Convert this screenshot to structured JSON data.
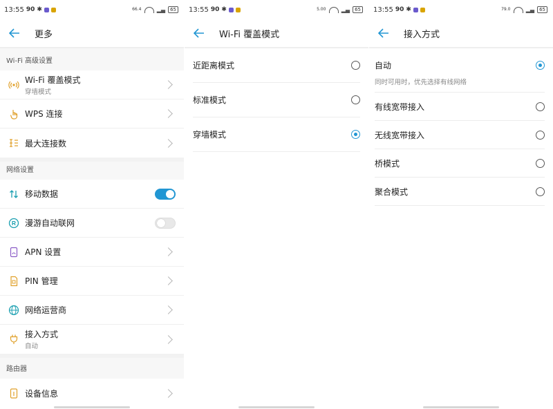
{
  "status": {
    "p1": {
      "time": "13:55",
      "sig": "90",
      "speed": "66.4",
      "batt": "65"
    },
    "p2": {
      "time": "13:55",
      "sig": "90",
      "speed": "5.00",
      "batt": "65"
    },
    "p3": {
      "time": "13:55",
      "sig": "90",
      "speed": "79.0",
      "batt": "65"
    }
  },
  "colors": {
    "accent": "#2196d3",
    "icon_orange": "#e0a02a",
    "icon_teal": "#1a9fb0",
    "icon_purple": "#8a5bc6"
  },
  "panel1": {
    "title": "更多",
    "sections": [
      {
        "label": "Wi-Fi 高级设置"
      },
      {
        "label": "网络设置"
      },
      {
        "label": "路由器"
      }
    ],
    "wifi_items": [
      {
        "label": "Wi-Fi 覆盖模式",
        "sub": "穿墙模式",
        "icon": "wifi-signal-icon"
      },
      {
        "label": "WPS 连接",
        "icon": "hand-tap-icon"
      },
      {
        "label": "最大连接数",
        "icon": "connection-list-icon"
      }
    ],
    "network_items": [
      {
        "label": "移动数据",
        "icon": "data-arrows-icon",
        "toggle": true
      },
      {
        "label": "漫游自动联网",
        "icon": "roaming-icon",
        "toggle": false
      },
      {
        "label": "APN 设置",
        "icon": "apn-icon"
      },
      {
        "label": "PIN 管理",
        "icon": "sim-pin-icon"
      },
      {
        "label": "网络运营商",
        "icon": "globe-icon"
      },
      {
        "label": "接入方式",
        "sub": "自动",
        "icon": "plug-icon"
      }
    ],
    "router_items": [
      {
        "label": "设备信息",
        "icon": "device-info-icon"
      }
    ]
  },
  "panel2": {
    "title": "Wi-Fi 覆盖模式",
    "options": [
      {
        "label": "近距离模式",
        "selected": false
      },
      {
        "label": "标准模式",
        "selected": false
      },
      {
        "label": "穿墙模式",
        "selected": true
      }
    ]
  },
  "panel3": {
    "title": "接入方式",
    "options": [
      {
        "label": "自动",
        "selected": true,
        "desc": "同时可用时，优先选择有线网络"
      },
      {
        "label": "有线宽带接入",
        "selected": false
      },
      {
        "label": "无线宽带接入",
        "selected": false
      },
      {
        "label": "桥模式",
        "selected": false
      },
      {
        "label": "聚合模式",
        "selected": false
      }
    ]
  }
}
